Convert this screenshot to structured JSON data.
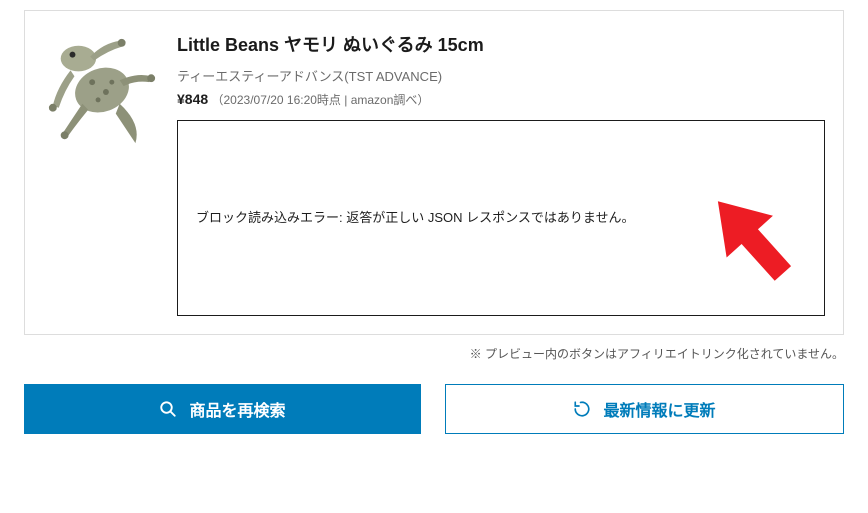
{
  "product": {
    "title": "Little Beans ヤモリ ぬいぐるみ 15cm",
    "brand": "ティーエスティーアドバンス(TST ADVANCE)",
    "currency": "¥",
    "price": "848",
    "meta": "（2023/07/20 16:20時点 | amazon調べ）"
  },
  "error": {
    "message": "ブロック読み込みエラー: 返答が正しい JSON レスポンスではありません。"
  },
  "note": "※ プレビュー内のボタンはアフィリエイトリンク化されていません。",
  "buttons": {
    "research": "商品を再検索",
    "refresh": "最新情報に更新"
  },
  "colors": {
    "primary": "#007cba",
    "arrow": "#ed1c24"
  }
}
